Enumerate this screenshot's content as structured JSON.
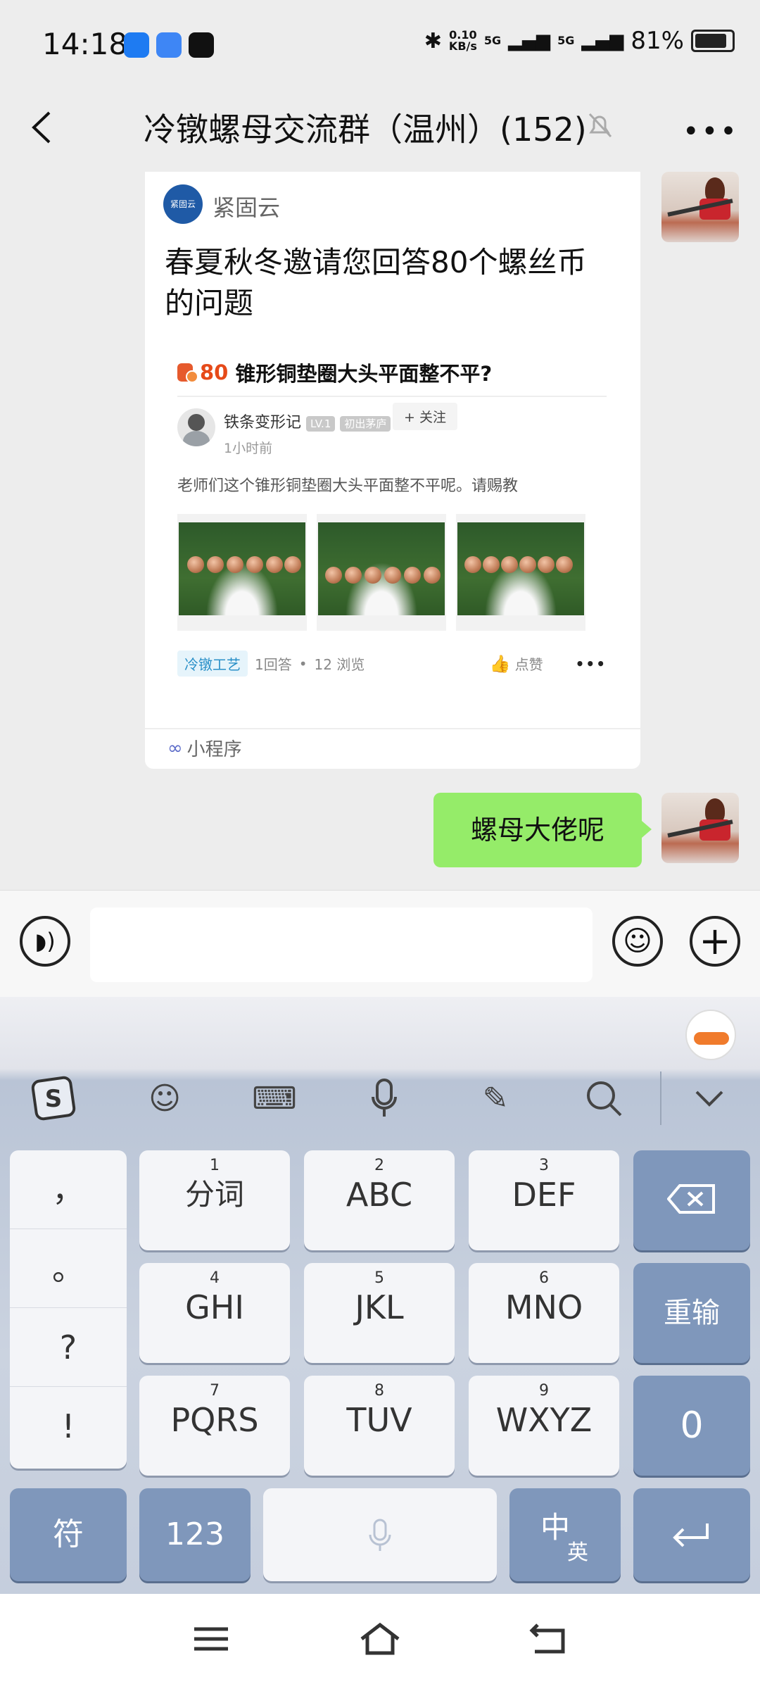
{
  "status_bar": {
    "time": "14:18",
    "net_speed_value": "0.10",
    "net_speed_unit": "KB/s",
    "signal1": "5G",
    "signal2": "5G",
    "battery": "81%"
  },
  "header": {
    "title": "冷镦螺母交流群（温州）(152)"
  },
  "card": {
    "logo_text": "紧固云",
    "source": "紧固云",
    "title": "春夏秋冬邀请您回答80个螺丝币的问题",
    "question_reward": "80",
    "question_title": "锥形铜垫圈大头平面整不平?",
    "author": "铁条变形记",
    "author_level": "LV.1",
    "author_badge": "初出茅庐",
    "follow_label": "+ 关注",
    "post_time": "1小时前",
    "body": "老师们这个锥形铜垫圈大头平面整不平呢。请赐教",
    "tag": "冷镦工艺",
    "answers": "1回答",
    "sep": "•",
    "views": "12 浏览",
    "like_label": "点赞",
    "more": "•••",
    "footer_label": "小程序"
  },
  "message": {
    "text": "螺母大佬呢"
  },
  "input_bar": {
    "value": ""
  },
  "keyboard": {
    "left_column": [
      "，",
      "。",
      "?",
      "!"
    ],
    "keys": [
      {
        "num": "1",
        "label": "分词"
      },
      {
        "num": "2",
        "label": "ABC"
      },
      {
        "num": "3",
        "label": "DEF"
      },
      {
        "num": "4",
        "label": "GHI"
      },
      {
        "num": "5",
        "label": "JKL"
      },
      {
        "num": "6",
        "label": "MNO"
      },
      {
        "num": "7",
        "label": "PQRS"
      },
      {
        "num": "8",
        "label": "TUV"
      },
      {
        "num": "9",
        "label": "WXYZ"
      }
    ],
    "retype_label": "重输",
    "zero_label": "0",
    "symbol_label": "符",
    "num_label": "123",
    "lang_main": "中",
    "lang_sub": "英",
    "colors": {
      "accent": "#7f97bb",
      "bubble": "#95ec69"
    }
  }
}
